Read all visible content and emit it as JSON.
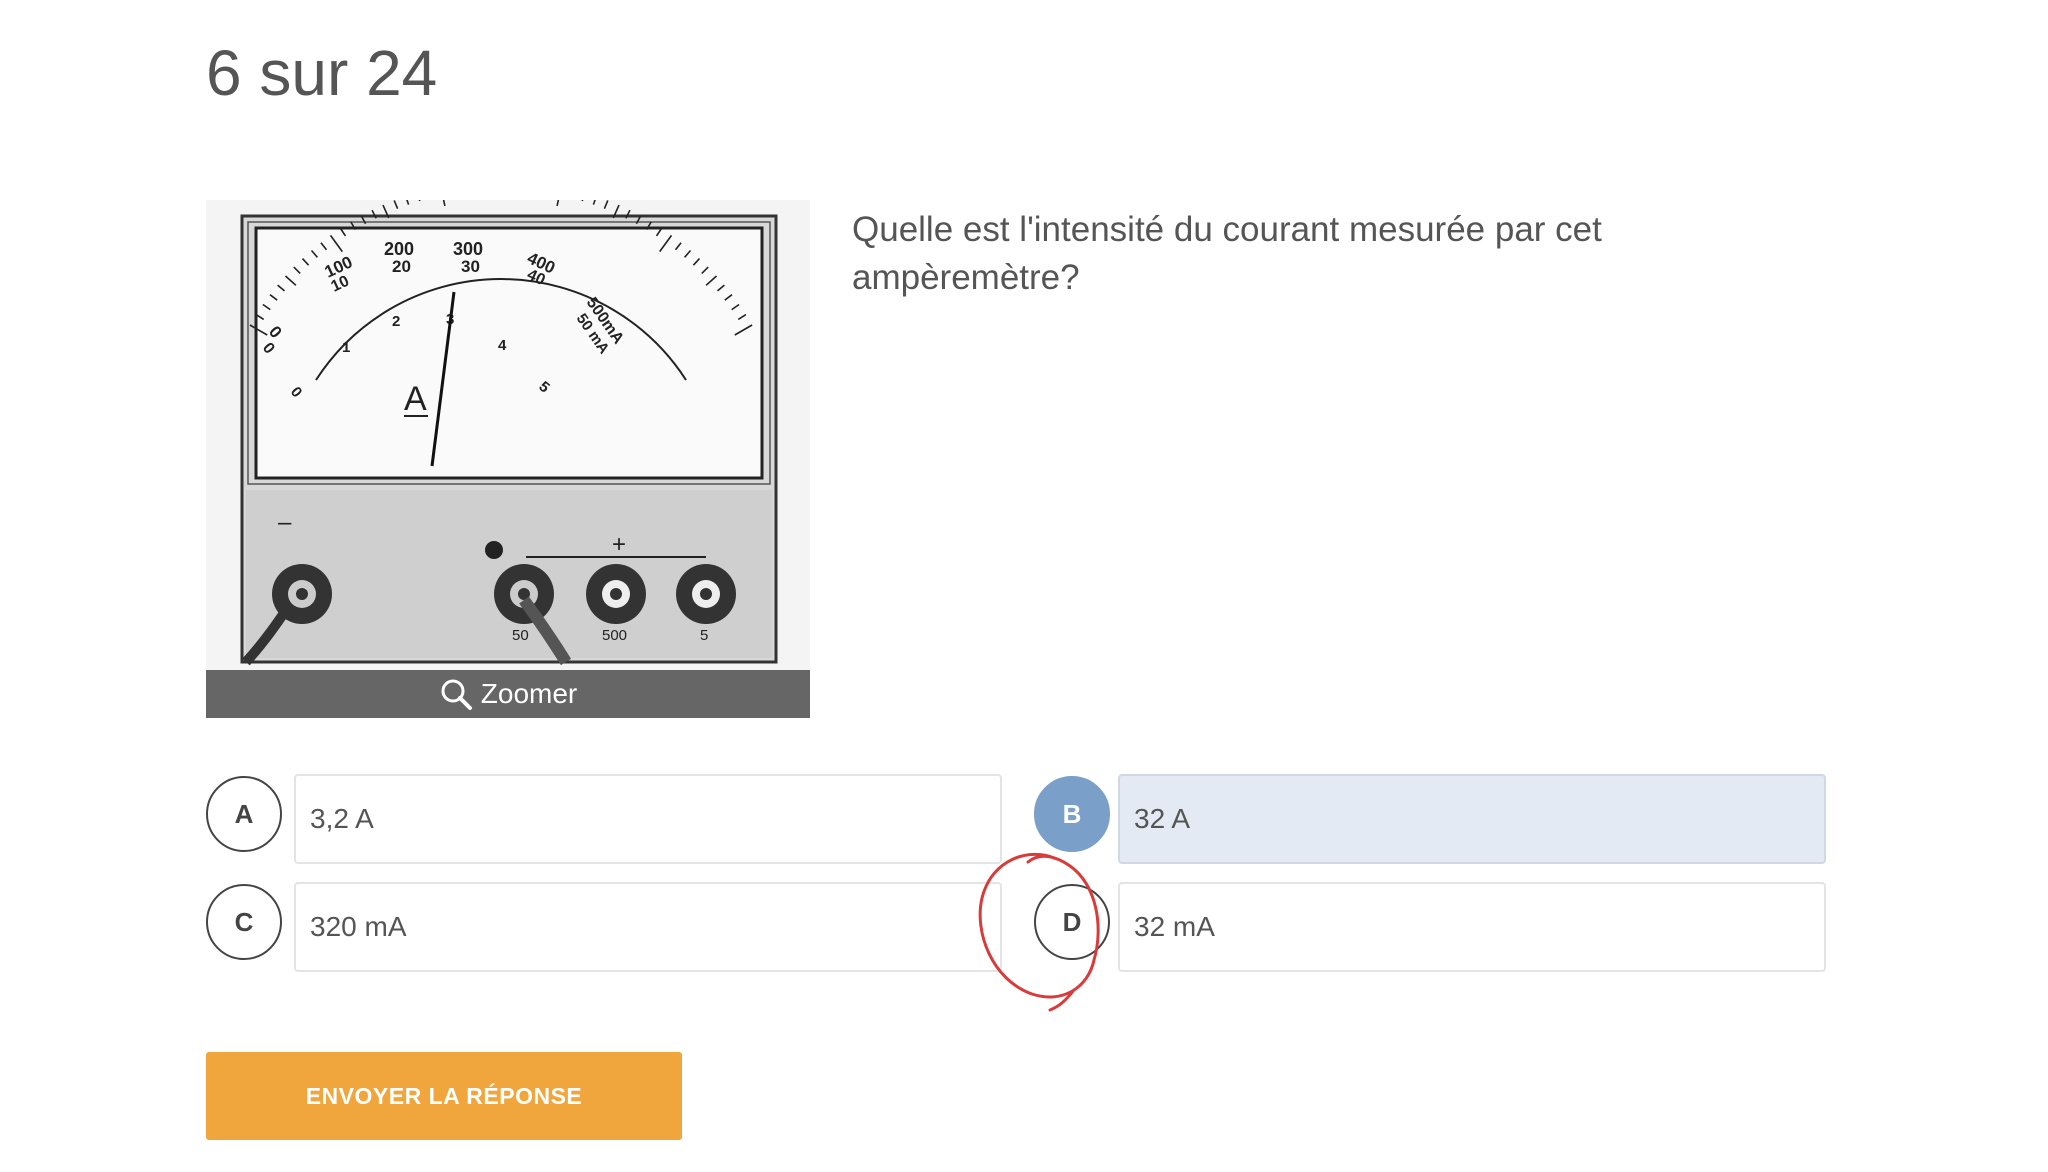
{
  "progress": "6 sur 24",
  "figure": {
    "zoom_label": "Zoomer",
    "meter": {
      "unit_symbol": "A",
      "scale_top": [
        "0",
        "100",
        "200",
        "300",
        "400",
        "500mA"
      ],
      "scale_mid": [
        "0",
        "10",
        "20",
        "30",
        "40",
        "50 mA"
      ],
      "scale_bottom": [
        "0",
        "1",
        "2",
        "3",
        "4",
        "5"
      ],
      "minus_label": "–",
      "plus_label": "+",
      "terminal_labels": [
        "50",
        "500",
        "5"
      ]
    }
  },
  "question": "Quelle est l'intensité du courant mesurée par cet ampèremètre?",
  "options": [
    {
      "letter": "A",
      "text": "3,2 A",
      "selected": false
    },
    {
      "letter": "B",
      "text": "32 A",
      "selected": true
    },
    {
      "letter": "C",
      "text": "320 mA",
      "selected": false
    },
    {
      "letter": "D",
      "text": "32 mA",
      "selected": false
    }
  ],
  "submit_label": "ENVOYER LA RÉPONSE",
  "colors": {
    "accent": "#f0a63c",
    "selected": "#7a9fc8",
    "selected_bg": "#e3eaf4",
    "annotation": "#d93b3b"
  }
}
